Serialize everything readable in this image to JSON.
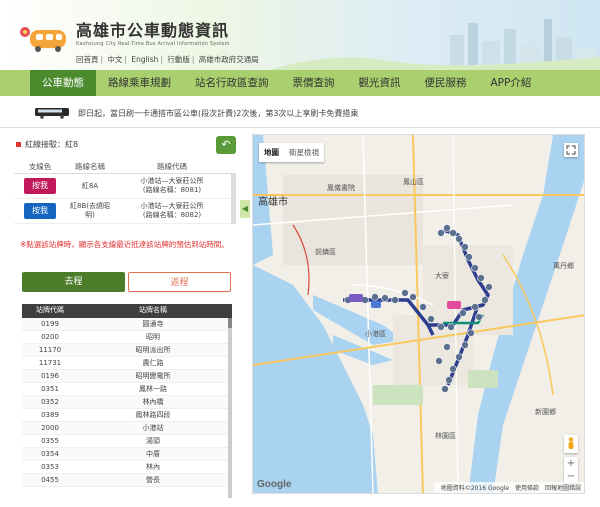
{
  "header": {
    "title": "高雄市公車動態資訊",
    "subtitle": "Kaohsiung City Real-Time Bus Arrival Information System",
    "links": [
      "回首頁",
      "中文",
      "English",
      "行動版",
      "高雄市政府交通局"
    ]
  },
  "nav": {
    "items": [
      "公車動態",
      "路線乘車規劃",
      "站名行政區查詢",
      "票價查詢",
      "觀光資訊",
      "便民服務",
      "APP介紹"
    ],
    "active": 0
  },
  "notice": {
    "text": "即日起，當日刷一卡通搭市區公車(段次計費)2次後，第3次以上享刷卡免費搭乘"
  },
  "route": {
    "label": "紅線接駁：紅8",
    "back_icon": "↶",
    "columns": [
      "支線色",
      "路線名稱",
      "路線代碼"
    ],
    "rows": [
      {
        "button": "按我",
        "color": "#c2185b",
        "name": "紅8A",
        "code1": "小港站—大寮莊公所",
        "code2": "(路線名稱：8081)"
      },
      {
        "button": "按我",
        "color": "#1565c0",
        "name": "紅8B(去繞昭明)",
        "code1": "小港站—大寮莊公所",
        "code2": "(路線名稱：8082)"
      }
    ],
    "warning": "※點選該站牌時，顯示各支線最近抵達該站牌的預估到站時間。"
  },
  "direction": {
    "go": "去程",
    "back": "返程"
  },
  "stops": {
    "columns": [
      "站牌代碼",
      "站牌名稱"
    ],
    "rows": [
      [
        "0199",
        "圓通寺"
      ],
      [
        "0200",
        "昭明"
      ],
      [
        "11170",
        "昭明派出所"
      ],
      [
        "11731",
        "農仁路"
      ],
      [
        "0196",
        "昭明變電所"
      ],
      [
        "0351",
        "鳳林一路"
      ],
      [
        "0352",
        "林內橋"
      ],
      [
        "0389",
        "鳳林路四段"
      ],
      [
        "2000",
        "小港站"
      ],
      [
        "0355",
        "湯頭"
      ],
      [
        "0354",
        "中厝"
      ],
      [
        "0353",
        "林內"
      ],
      [
        "0455",
        "營長"
      ]
    ]
  },
  "map": {
    "tabs": [
      "地圖",
      "衛星檢視"
    ],
    "places": [
      {
        "name": "高雄市",
        "big": true
      },
      {
        "name": "鳳山區",
        "big": false
      },
      {
        "name": "鳳儀書院",
        "big": false
      },
      {
        "name": "前鎮區",
        "big": false
      },
      {
        "name": "大寮",
        "big": false
      },
      {
        "name": "小港區",
        "big": false
      },
      {
        "name": "林園區",
        "big": false
      },
      {
        "name": "萬丹鄉",
        "big": false
      },
      {
        "name": "新園鄉",
        "big": false
      }
    ],
    "footer": [
      "地圖資料©2016 Google",
      "使用條款",
      "回報地圖錯誤"
    ],
    "logo": "Google",
    "zoom_in": "+",
    "zoom_out": "−"
  }
}
